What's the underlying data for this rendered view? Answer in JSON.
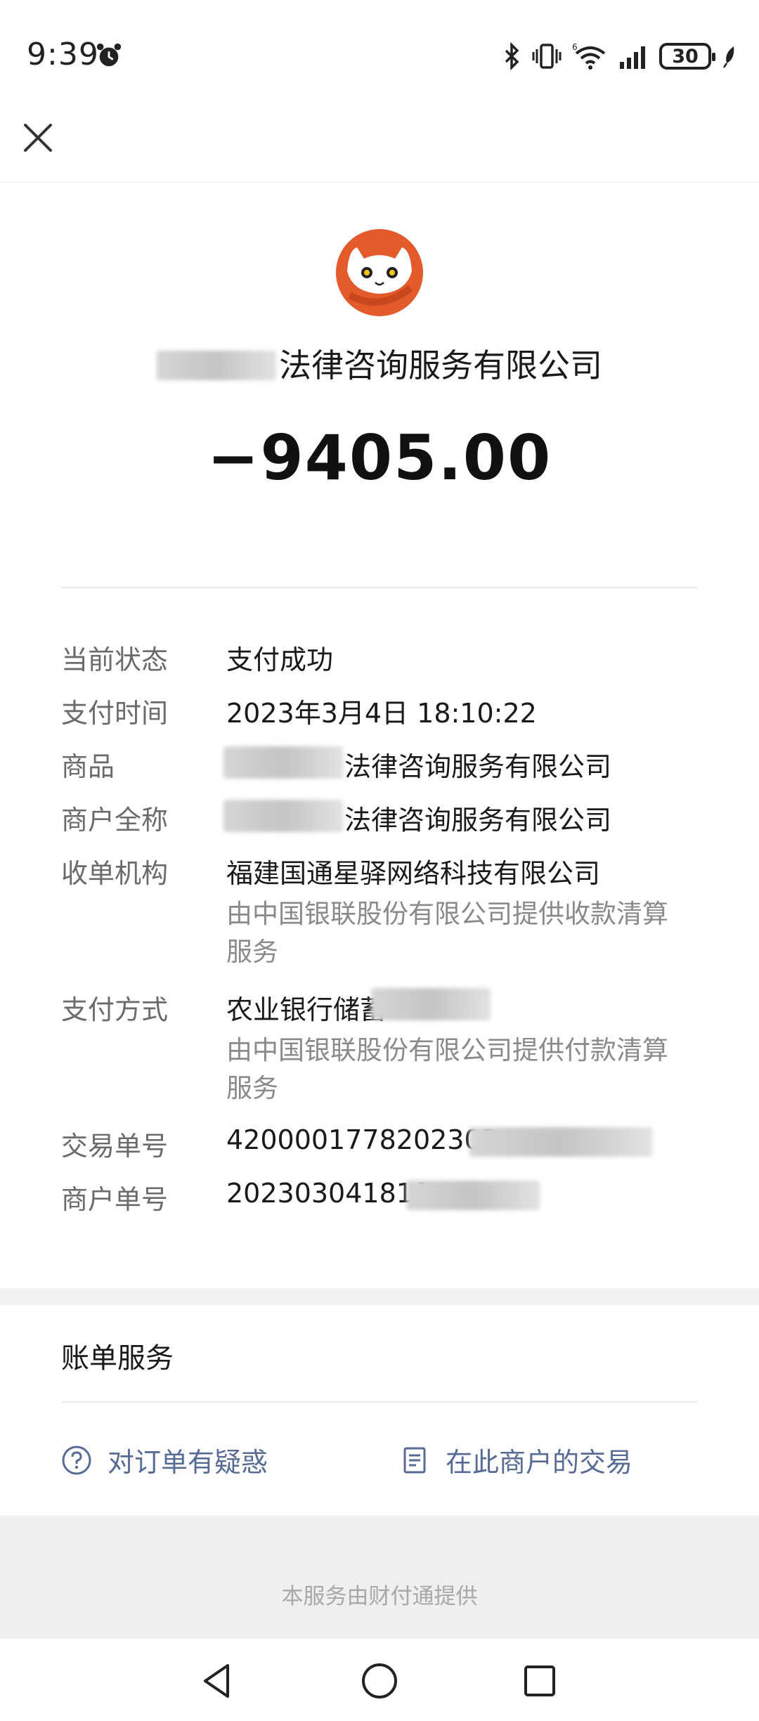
{
  "status_bar": {
    "time": "9:39",
    "battery": "30",
    "icons": [
      "alarm-icon",
      "bluetooth-icon",
      "vibrate-icon",
      "wifi-6-icon",
      "signal-icon",
      "battery-icon",
      "leaf-icon"
    ]
  },
  "header": {
    "close_icon": "close-icon"
  },
  "merchant": {
    "name_suffix": "法律咨询服务有限公司",
    "amount": "−9405.00"
  },
  "details": {
    "status": {
      "label": "当前状态",
      "value": "支付成功"
    },
    "pay_time": {
      "label": "支付时间",
      "value": "2023年3月4日 18:10:22"
    },
    "goods": {
      "label": "商品",
      "value": "法律咨询服务有限公司"
    },
    "merchant_fullname": {
      "label": "商户全称",
      "value": "法律咨询服务有限公司"
    },
    "acquirer": {
      "label": "收单机构",
      "value": "福建国通星驿网络科技有限公司",
      "note": "由中国银联股份有限公司提供收款清算服务"
    },
    "pay_method": {
      "label": "支付方式",
      "value": "农业银行储蓄",
      "note": "由中国银联股份有限公司提供付款清算服务"
    },
    "transaction_no": {
      "label": "交易单号",
      "value": "4200001778202303"
    },
    "merchant_order_no": {
      "label": "商户单号",
      "value": "202303041810"
    }
  },
  "bill_service": {
    "title": "账单服务",
    "question_action": "对订单有疑惑",
    "merchant_tx_action": "在此商户的交易"
  },
  "footer": {
    "text": "本服务由财付通提供"
  },
  "colors": {
    "link": "#576b95",
    "logo": "#e45a2a"
  }
}
